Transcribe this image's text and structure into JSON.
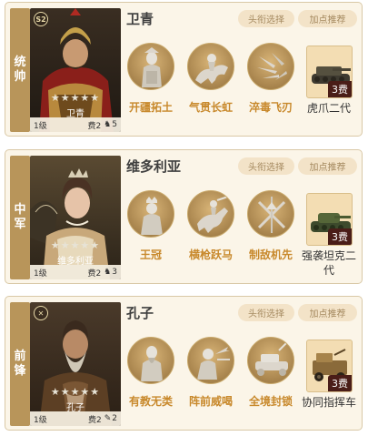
{
  "cards": [
    {
      "role": [
        "统",
        "帅"
      ],
      "name": "卫青",
      "badge": "S2",
      "stars": "★★★★★",
      "portrait_name": "卫青",
      "level": "1级",
      "cost": "费2",
      "glyph": "horse-icon",
      "glyph_char": "♞",
      "glyph_count": "5",
      "title_select": "头衔选择",
      "points_rec": "加点推荐",
      "skills": [
        "开疆拓土",
        "气贯长虹",
        "淬毒飞刃"
      ],
      "equipment": {
        "name": "虎爪二代",
        "cost": "3费"
      }
    },
    {
      "role": [
        "中",
        "军"
      ],
      "name": "维多利亚",
      "badge": "",
      "stars": "★★★★★",
      "portrait_name": "维多利亚",
      "level": "1级",
      "cost": "费2",
      "glyph": "horse-icon",
      "glyph_char": "♞",
      "glyph_count": "3",
      "title_select": "头衔选择",
      "points_rec": "加点推荐",
      "skills": [
        "王冠",
        "横枪跃马",
        "制敌机先"
      ],
      "equipment": {
        "name": "强袭坦克二代",
        "cost": "3费"
      }
    },
    {
      "role": [
        "前",
        "锋"
      ],
      "name": "孔子",
      "badge": "✕",
      "stars": "★★★★★",
      "portrait_name": "孔子",
      "level": "1级",
      "cost": "费2",
      "glyph": "brush-icon",
      "glyph_char": "✎",
      "glyph_count": "2",
      "title_select": "头衔选择",
      "points_rec": "加点推荐",
      "skills": [
        "有教无类",
        "阵前威喝",
        "全境封锁"
      ],
      "equipment": {
        "name": "协同指挥车",
        "cost": "3费"
      }
    }
  ]
}
